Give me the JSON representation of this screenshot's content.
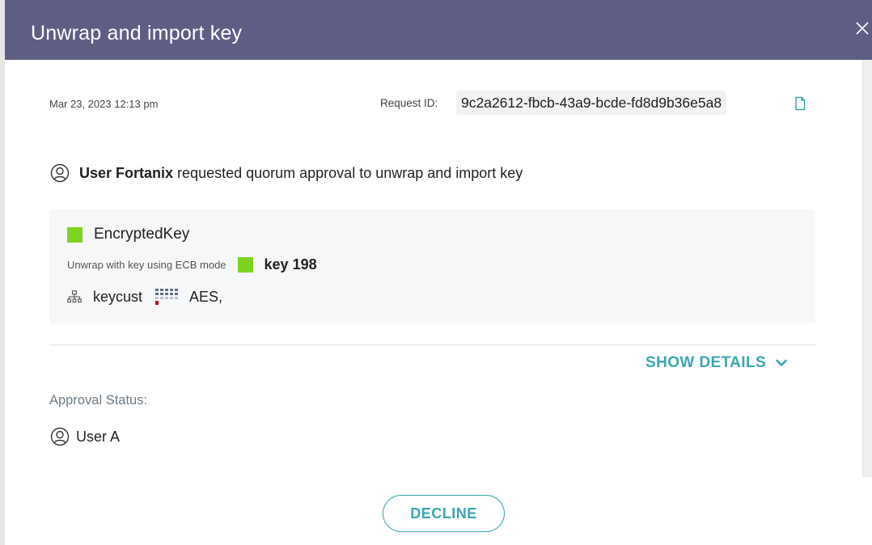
{
  "dialog": {
    "title": "Unwrap and import key"
  },
  "request": {
    "date": "Mar 23, 2023 12:13 pm",
    "id_label": "Request ID:",
    "id_value": "9c2a2612-fbcb-43a9-bcde-fd8d9b36e5a8",
    "requester": "User Fortanix",
    "description": "requested quorum approval to unwrap and import key"
  },
  "key": {
    "name": "EncryptedKey",
    "unwrap_text": "Unwrap with key using ECB mode",
    "wrapping_key": "key 198",
    "group": "keycust",
    "algorithm": "AES,"
  },
  "details": {
    "toggle_label": "SHOW DETAILS"
  },
  "approval": {
    "label": "Approval Status:",
    "approvers": [
      "User A"
    ]
  },
  "actions": {
    "decline_label": "DECLINE"
  },
  "colors": {
    "header_bg": "#5e5e85",
    "accent": "#3aa7b2",
    "key_indicator": "#7ed321",
    "strength_low": "#d0021b"
  },
  "icons": {
    "close": "close-icon",
    "copy": "copy-icon",
    "user": "user-circle-icon",
    "group": "group-hierarchy-icon",
    "strength": "key-strength-icon",
    "chevron": "chevron-down-icon"
  }
}
